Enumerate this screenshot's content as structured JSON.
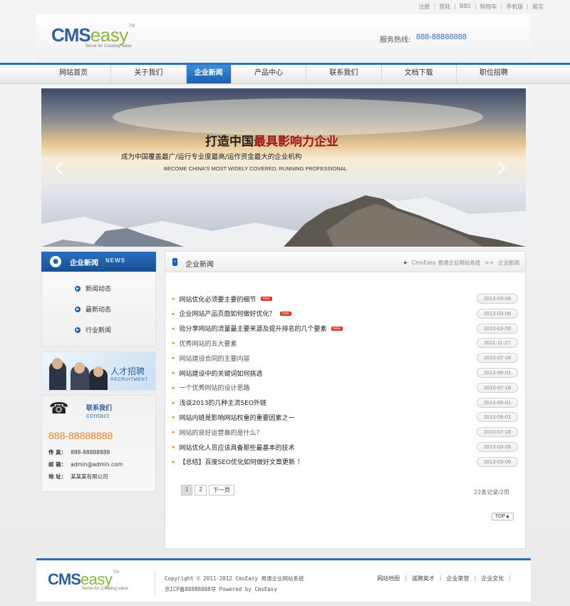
{
  "top_links": [
    "注册",
    "登陆",
    "BBS",
    "购物车",
    "手机版",
    "留言"
  ],
  "header": {
    "logo_cms": "CMS",
    "logo_easy": "easy",
    "logo_tm": "TM",
    "logo_slogan": "Serve for Creating value",
    "hotline_label": "服务热线:",
    "hotline_number": "888-88888888"
  },
  "nav": [
    "网站首页",
    "关于我们",
    "企业新闻",
    "产品中心",
    "联系我们",
    "文档下载",
    "职位招聘"
  ],
  "nav_active_index": 2,
  "banner": {
    "title_prefix": "打造中国",
    "title_highlight": "最具影响力企业",
    "subtitle": "成为中国覆盖最广/运行专业度最高/运作资金最大的企业机构",
    "english": "BECOME CHINA'S MOST WIDELY COVERED, RUNNING PROFESSIONAL",
    "prev": "‹",
    "next": "›"
  },
  "sidebar": {
    "title": "企业新闻",
    "title_en": "NEWS",
    "items": [
      "新闻动态",
      "最新动态",
      "行业新闻"
    ],
    "recruit_title": "人才招聘",
    "recruit_en": "RECRUITMENT",
    "contact_title": "联系我们",
    "contact_en": "contact",
    "contact_phone_big": "888-88888888",
    "fax_label": "传 真：",
    "fax": "888-88888888",
    "email_label": "邮 箱：",
    "email": "admin@admin.com",
    "address_label": "地 址：",
    "address": "某某某有限公司"
  },
  "main": {
    "title": "企业新闻",
    "breadcrumb_site": "CmsEasy 易通企业网站系统",
    "breadcrumb_sep": ">>",
    "breadcrumb_current": "企业新闻",
    "new_badge": "new",
    "news": [
      {
        "title": "网站优化必须要主要的细节",
        "date": "2013-03-06",
        "new": true,
        "gray": false
      },
      {
        "title": "企业网站产品页面如何做好优化？",
        "date": "2013-03-06",
        "new": true,
        "gray": false
      },
      {
        "title": "验分享网站的流量最主要来源及提升排名的几个要素",
        "date": "2013-03-06",
        "new": true,
        "gray": false
      },
      {
        "title": "优秀网站的五大要素",
        "date": "2011-11-27",
        "new": false,
        "gray": true
      },
      {
        "title": "网站建设合同的主要内容",
        "date": "2010-07-18",
        "new": false,
        "gray": true
      },
      {
        "title": "网站建设中的关键词如何挑选",
        "date": "2013-06-01",
        "new": false,
        "gray": false
      },
      {
        "title": "一个优秀网站的设计思路",
        "date": "2010-07-18",
        "new": false,
        "gray": true
      },
      {
        "title": "浅谈2013的几种主流SEO外链",
        "date": "2013-06-01",
        "new": false,
        "gray": false
      },
      {
        "title": "网站内链是影响网站权重的重要因素之一",
        "date": "2013-06-01",
        "new": false,
        "gray": false
      },
      {
        "title": "网站的良好运营靠的是什么？",
        "date": "2010-07-18",
        "new": false,
        "gray": true
      },
      {
        "title": "网站优化人员应该具备那些最基本的技术",
        "date": "2013-03-28",
        "new": false,
        "gray": false
      },
      {
        "title": "【总结】百度SEO优化如何做好文章更新 ！",
        "date": "2013-03-06",
        "new": false,
        "gray": false
      }
    ],
    "pages": [
      "1",
      "2"
    ],
    "next_page": "下一页",
    "records": "22条记录/2页",
    "top_button": "TOP▲"
  },
  "footer": {
    "copyright": "Copyright © 2011-2012  CmsEasy 易通企业网站系统",
    "icp": "京ICP备88888888号  Powered by  CmsEasy",
    "links": [
      "网站地图",
      "诚聘英才",
      "企业荣誉",
      "企业文化"
    ]
  },
  "colors": {
    "brand_blue": "#2d6fc1",
    "logo_green": "#8cb63c",
    "hotline": "#2f6bbf",
    "orange": "#f08020"
  }
}
